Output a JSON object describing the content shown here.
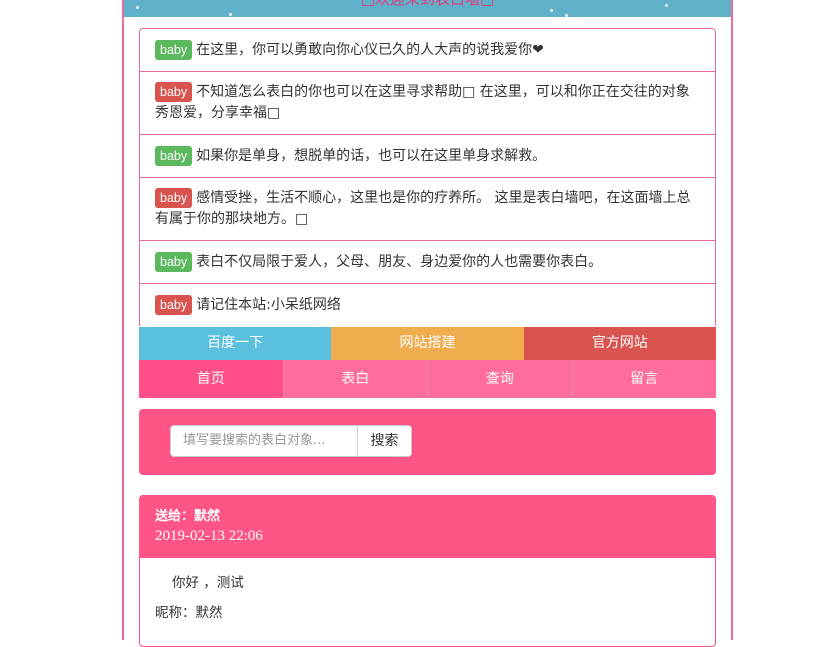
{
  "banner": {
    "title": "□欢迎来到表白墙□"
  },
  "intro_items": [
    {
      "badge": "baby",
      "badge_color": "#5cb85c",
      "text": "在这里，你可以勇敢向你心仪已久的人大声的说我爱你❤"
    },
    {
      "badge": "baby",
      "badge_color": "#d9534f",
      "text": "不知道怎么表白的你也可以在这里寻求帮助□ 在这里，可以和你正在交往的对象秀恩爱，分享幸福□"
    },
    {
      "badge": "baby",
      "badge_color": "#5cb85c",
      "text": "如果你是单身，想脱单的话，也可以在这里单身求解救。"
    },
    {
      "badge": "baby",
      "badge_color": "#d9534f",
      "text": "感情受挫，生活不顺心，这里也是你的疗养所。 这里是表白墙吧，在这面墙上总有属于你的那块地方。□"
    },
    {
      "badge": "baby",
      "badge_color": "#5cb85c",
      "text": "表白不仅局限于爱人，父母、朋友、身边爱你的人也需要你表白。"
    },
    {
      "badge": "baby",
      "badge_color": "#d9534f",
      "text": "请记住本站:小呆纸网络"
    }
  ],
  "buttons": [
    "百度一下",
    "网站搭建",
    "官方网站"
  ],
  "nav": [
    "首页",
    "表白",
    "查询",
    "留言"
  ],
  "search": {
    "placeholder": "填写要搜索的表白对象...",
    "button": "搜索"
  },
  "post": {
    "to": "送给：默然",
    "date": "2019-02-13 22:06",
    "message": "你好 ，测试",
    "nickname": "昵称：默然"
  },
  "colors": {
    "accent": "#ff5586",
    "border": "#e96c9c"
  }
}
